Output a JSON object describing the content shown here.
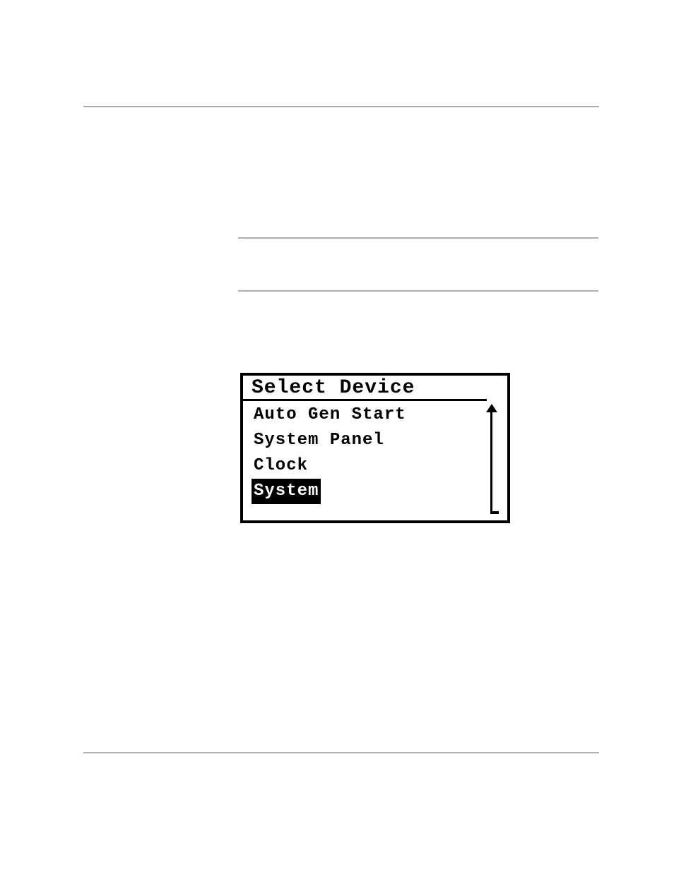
{
  "lcd": {
    "title": "Select Device",
    "items": [
      {
        "label": "Auto Gen Start",
        "selected": false
      },
      {
        "label": "System Panel",
        "selected": false
      },
      {
        "label": "Clock",
        "selected": false
      },
      {
        "label": "System",
        "selected": true
      }
    ]
  }
}
